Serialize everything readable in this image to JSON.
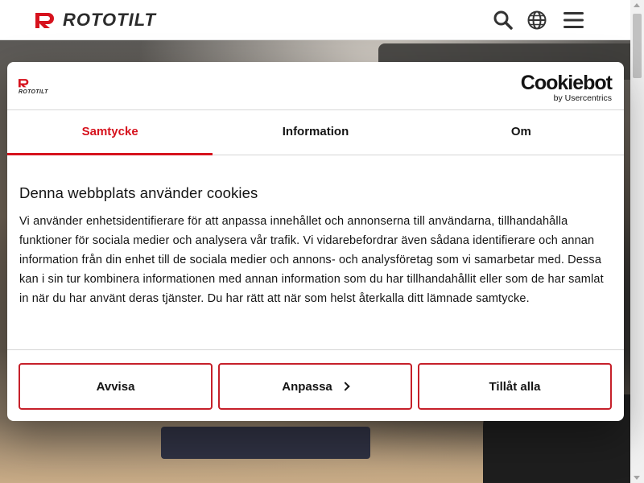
{
  "site_header": {
    "logo_text": "ROTOTILT",
    "icons": [
      "search-icon",
      "globe-icon",
      "menu-icon"
    ]
  },
  "dialog": {
    "logo_text": "ROTOTILT",
    "cookiebot_name": "Cookiebot",
    "cookiebot_sub": "by Usercentrics",
    "tabs": [
      {
        "label": "Samtycke",
        "active": true
      },
      {
        "label": "Information",
        "active": false
      },
      {
        "label": "Om",
        "active": false
      }
    ],
    "title": "Denna webbplats använder cookies",
    "text": "Vi använder enhetsidentifierare för att anpassa innehållet och annonserna till användarna, tillhandahålla funktioner för sociala medier och analysera vår trafik. Vi vidarebefordrar även sådana identifierare och annan information från din enhet till de sociala medier och annons- och analysföretag som vi samarbetar med. Dessa kan i sin tur kombinera informationen med annan information som du har tillhandahållit eller som de har samlat in när du har använt deras tjänster. Du har rätt att när som helst återkalla ditt lämnade samtycke.",
    "buttons": {
      "reject": "Avvisa",
      "customize": "Anpassa",
      "allow_all": "Tillåt alla"
    }
  },
  "colors": {
    "brand_red": "#d6121d",
    "button_border": "#c6202a",
    "text": "#141414"
  }
}
